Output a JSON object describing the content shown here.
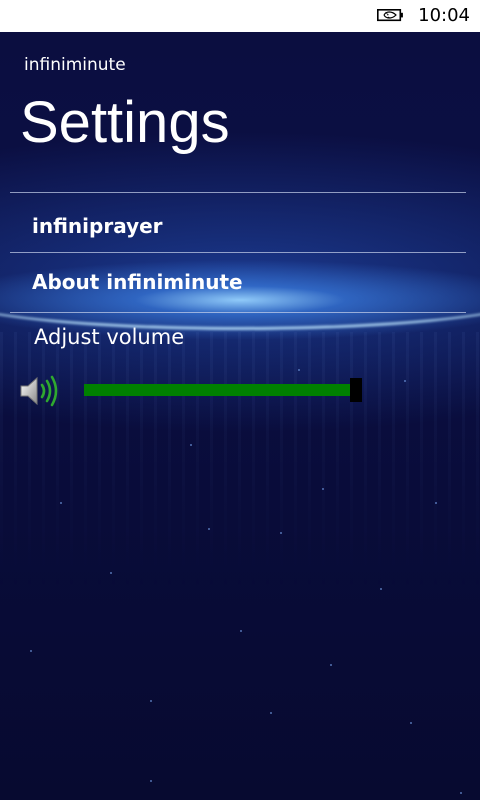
{
  "status_bar": {
    "time": "10:04",
    "battery_icon": "battery-charging-icon"
  },
  "header": {
    "app_title": "infiniminute",
    "page_title": "Settings"
  },
  "menu": {
    "items": [
      {
        "label": "infiniprayer"
      },
      {
        "label": "About infiniminute"
      }
    ]
  },
  "volume": {
    "label": "Adjust volume",
    "icon": "speaker-icon",
    "level": 1.0
  },
  "colors": {
    "background": "#0a0c3a",
    "slider_fill": "#008000",
    "slider_thumb": "#000000",
    "text": "#ffffff"
  }
}
